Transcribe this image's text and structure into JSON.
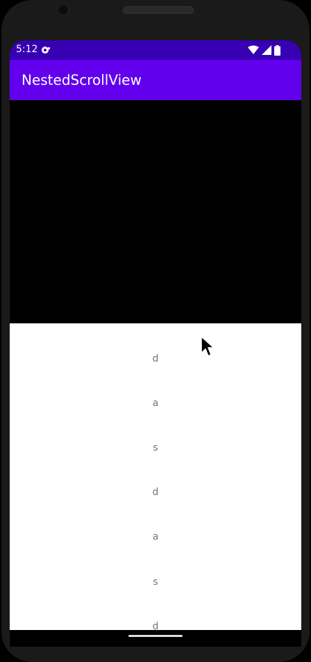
{
  "status_bar": {
    "time": "5:12",
    "background": "#3700b3",
    "icons": [
      "notification-icon",
      "wifi-icon",
      "signal-icon",
      "battery-icon"
    ]
  },
  "app_bar": {
    "title": "NestedScrollView",
    "background": "#6200ee"
  },
  "list": {
    "items": [
      "d",
      "a",
      "s",
      "d",
      "a",
      "s",
      "d"
    ],
    "text_color": "#757575",
    "background": "#ffffff"
  },
  "device": {
    "frame_color": "#1a1a1b"
  }
}
